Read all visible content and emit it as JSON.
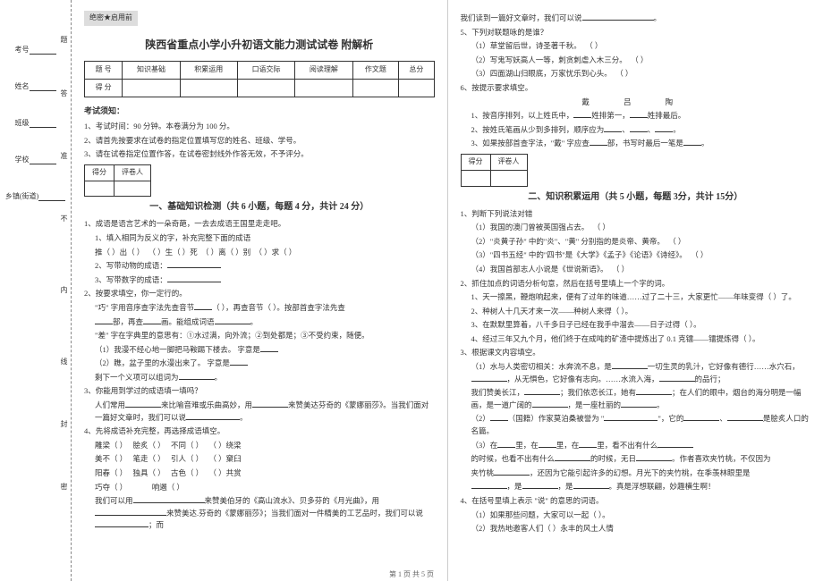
{
  "margin": {
    "labels": [
      "考号",
      "姓名",
      "班级",
      "学校",
      "乡镇(街道)"
    ],
    "inner_marks": [
      "题",
      "答",
      "准",
      "不",
      "内",
      "线",
      "封",
      "密"
    ]
  },
  "secret_mark": "绝密★启用前",
  "title": "陕西省重点小学小升初语文能力测试试卷 附解析",
  "score_headers": [
    "题 号",
    "知识基础",
    "积累运用",
    "口语交际",
    "阅读理解",
    "作文题",
    "总分"
  ],
  "score_row2": "得 分",
  "notice_head": "考试须知：",
  "notices": [
    "1、考试时间：90 分钟。本卷满分为 100 分。",
    "2、请首先按要求在试卷的指定位置填写您的姓名、班级、学号。",
    "3、请在试卷指定位置作答，在试卷密封线外作答无效，不予评分。"
  ],
  "mini_header": [
    "得分",
    "评卷人"
  ],
  "section1_title": "一、基础知识检测（共 6 小题，每题 4 分，共计 24 分）",
  "q1": {
    "stem": "1、成语是语言艺术的一朵奇葩，一去去成语王国里走走吧。",
    "s1": "1、填入相同为反义的字，补充完整下面的成语",
    "s1_items": [
      "推（ ）出（ ）",
      "（ ）生（ ）死",
      "（ ）离（ ）别",
      "（ ）求（ ）"
    ],
    "s2": "2、写带动物的成语：",
    "s3": "3、写带数字的成语："
  },
  "q2": {
    "stem": "2、按要求填空，你一定行的。",
    "line1_a": "\"巧\" 字用音序查字法先查音节",
    "line1_b": "，再查音节",
    "line1_c": "。按部首查字法先查",
    "line2_a": "部，再查",
    "line2_b": "画。能组成词语",
    "line3": "\"差\" 字在字典里的意思有：①水过满，向外流；②到处都是；③不受约束，随便。",
    "sub1": "（1）我漫不经心地一脚把马鞍踢下楼去。   字意是",
    "sub2": "（2）瞧，盆子里的水漫出来了。   字意是",
    "sub3_a": "剩下一个义项可以组词为"
  },
  "q3": {
    "stem": "3、你能用到学过的成语填一填吗？",
    "line1_a": "人们常用",
    "line1_b": "来比喻音难或乐曲高妙，用",
    "line1_c": "来赞美达芬奇的《蒙娜丽莎》。当我们面对一篇好文章时，我们可以说"
  },
  "q4": {
    "stem": "4、先将成语补充完整，再选择成语填空。",
    "rows": [
      [
        "雕梁（ ）",
        "脍炙（ ）",
        "不同（ ）",
        "（ ）绕梁"
      ],
      [
        "美不（ ）",
        "笔走（ ）",
        "引人（ ）",
        "（ ）窠臼"
      ],
      [
        "阳春（ ）",
        "独具（ ）",
        "古色（ ）",
        "（ ）共赏"
      ],
      [
        "巧夺（ ）",
        "",
        "响遏（ ）",
        ""
      ]
    ],
    "tail_a": "我们可以用",
    "tail_b": "来赞美伯牙的《高山流水》、贝多芬的《月光曲》，用",
    "tail_c": "来赞美达.芬奇的《蒙娜丽莎》；当我们面对一件精美的工艺品时，我们可以说",
    "tail_d": "；而"
  },
  "right": {
    "top_a": "我们读到一篇好文章时，我们可以说",
    "q5": "5、下列对联题咏的是谁？",
    "q5_items": [
      "（1）草堂留后世，诗圣著千秋。",
      "（2）写鬼写妖高人一等，刺贪刺虐入木三分。",
      "（3）四面湖山归眼底，万家忧乐到心头。"
    ],
    "q6": "6、按提示要求填空。",
    "q6_center": "戴     吕     陶",
    "q6_1_a": "1、按音序排列，以上姓氏中，",
    "q6_1_b": "姓排第一，",
    "q6_1_c": "姓排最后。",
    "q6_2_a": "2、按姓氏笔画从少到多排列，顺序应为",
    "q6_3_a": "3、如果按部首查字法，\"戴\" 字应查",
    "q6_3_b": "部，书写时最后一笔是",
    "section2_title": "二、知识积累运用（共 5 小题，每题 3分，共计 15分）",
    "r1": "1、判断下列说法对错",
    "r1_items": [
      "（1）我国的澳门曾被英国强占去。",
      "（2）\"炎黄子孙\" 中的\"炎\"、\"黄\" 分别指的是炎帝、黄帝。",
      "（3）\"四书五经\" 中的\"四书\"是《大学》《孟子》《论语》《诗经》。",
      "（4）我国首部志人小说是《世说新语》。"
    ],
    "r2": "2、抓住加点的词语分析句意，然后在括号里填上一个字的词。",
    "r2_1": "1、天一擦黑，鞭炮响起来，便有了过年的味道……过了二十三，大家更忙——年味变得（   ）了。",
    "r2_2": "2、种树人十几天才来一次——种树人来得（   ）。",
    "r2_3": "3、在默默里算着，八千多日子已经在我手中溜去——日子过得（   ）。",
    "r2_4": "4、经过三年又九个月，他们终于在成吨的矿渣中提炼出了 0.1 克镭——镭提炼得（   ）。",
    "r3": "3、根据课文内容填空。",
    "r3_1_a": "（1）水与人类密切相关：水奔流不息，是",
    "r3_1_b": "一切生灵的乳汁，它好像有德行……",
    "r3_1_c": "水穴石，",
    "r3_1_d": "，从无惧色，它好像有志向。",
    "r3_1_e": "……水流入海，",
    "r3_1_f": "的品行；",
    "r3_2_a": "我们赞美长江，",
    "r3_2_b": "；我们依恋长江，她有",
    "r3_2_c": "；在人们的眼中，烟台的海分明是",
    "r3_2_d": "一幅画，是一道广阔的",
    "r3_2_e": "，是一座杜丽的",
    "r3_3_a": "（2）",
    "r3_3_b": "（国籍）作家莫泊桑被誉为 \"",
    "r3_3_c": "\"，它的",
    "r3_3_d": "是脍炙人口的名篇。",
    "r3_4_a": "（3）在",
    "r3_4_b": "里，在",
    "r3_4_c": "里，在",
    "r3_4_d": "里，看不出有什么",
    "r3_5_a": "的时候，也看不出有什么",
    "r3_5_b": "的时候，无日",
    "r3_5_c": "。作者喜欢夹竹桃，不仅因为",
    "r3_6_a": "夹竹桃",
    "r3_6_b": "，还因为它能引起许多的幻想。月光下的夹竹桃，在季羡林眼里是",
    "r3_7_a": "，是",
    "r3_7_b": "，是",
    "r3_7_c": "。真是浮想联翩，妙趣横生啊！",
    "r4": "4、在括号里填上表示 \"说\" 的意思的词语。",
    "r4_1": "（1）如果那些问题，大家可以一起（    ）。",
    "r4_2": "（2）我热地邀客人们（    ）永丰的风土人情"
  },
  "footer": "第 1 页 共 5 页"
}
